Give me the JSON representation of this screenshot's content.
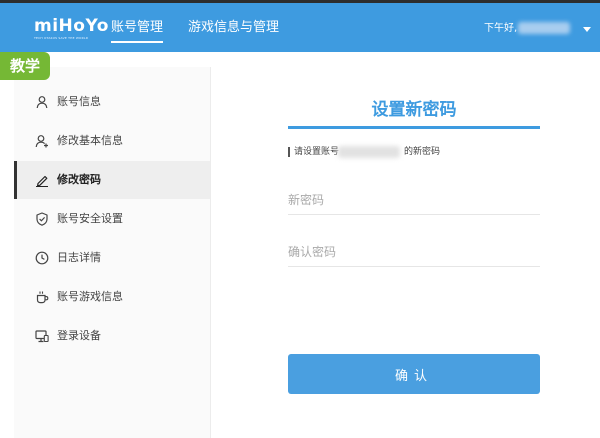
{
  "header": {
    "logo_text": "miHoYo",
    "logo_tagline": "TECH OTAKUS SAVE THE WORLD",
    "tabs": [
      {
        "label": "账号管理",
        "active": true
      },
      {
        "label": "游戏信息与管理",
        "active": false
      }
    ],
    "greeting": "下午好,"
  },
  "badge": "教学",
  "sidebar": {
    "items": [
      {
        "label": "账号信息",
        "icon": "user-icon",
        "active": false
      },
      {
        "label": "修改基本信息",
        "icon": "user-edit-icon",
        "active": false
      },
      {
        "label": "修改密码",
        "icon": "pencil-icon",
        "active": true
      },
      {
        "label": "账号安全设置",
        "icon": "shield-check-icon",
        "active": false
      },
      {
        "label": "日志详情",
        "icon": "clock-icon",
        "active": false
      },
      {
        "label": "账号游戏信息",
        "icon": "cup-icon",
        "active": false
      },
      {
        "label": "登录设备",
        "icon": "devices-icon",
        "active": false
      }
    ]
  },
  "main": {
    "title": "设置新密码",
    "hint_prefix": "请设置账号",
    "hint_suffix": "的新密码",
    "new_password_placeholder": "新密码",
    "confirm_password_placeholder": "确认密码",
    "confirm_label": "确认"
  },
  "colors": {
    "header": "#3e9be0",
    "accent": "#3e9be0",
    "badge": "#75b835",
    "button": "#4a9fe0"
  }
}
